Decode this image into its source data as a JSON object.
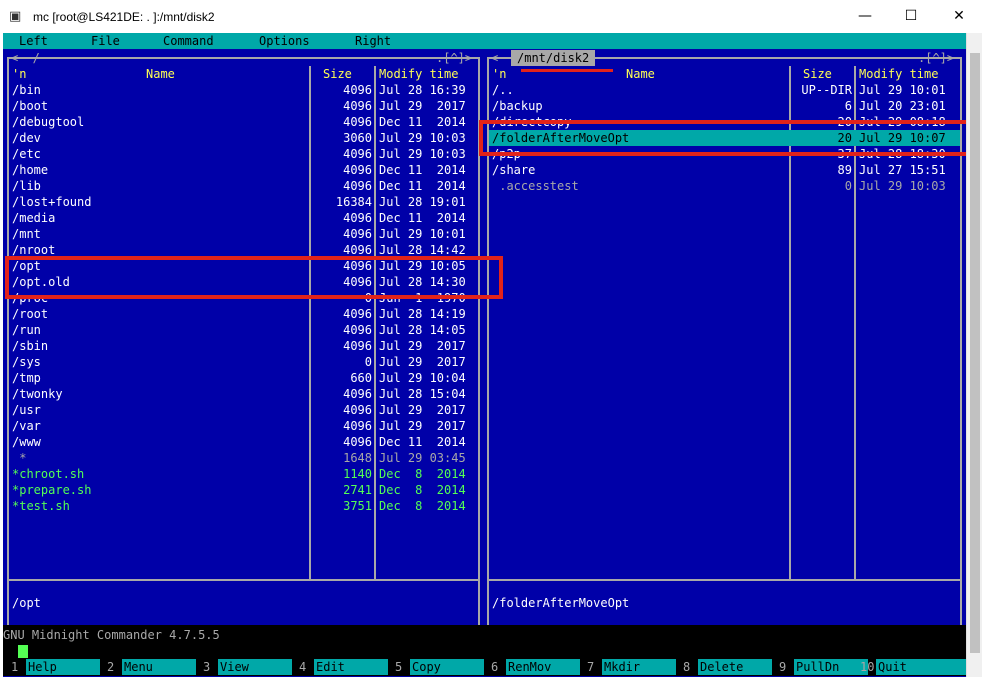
{
  "window": {
    "title": "mc [root@LS421DE:  .   ]:/mnt/disk2",
    "icon_name": "putty-icon",
    "minimize_icon": "—",
    "maximize_icon": "☐",
    "close_icon": "✕"
  },
  "menu": [
    "Left",
    "File",
    "Command",
    "Options",
    "Right"
  ],
  "left_panel": {
    "top_left": "<─ /",
    "top_right": ".[^]>",
    "col_n": "'n",
    "col_name": "Name",
    "col_size": "Size",
    "col_time": "Modify time",
    "files": [
      {
        "name": "/bin",
        "size": "4096",
        "time": "Jul 28 16:39",
        "kind": "dir"
      },
      {
        "name": "/boot",
        "size": "4096",
        "time": "Jul 29  2017",
        "kind": "dir"
      },
      {
        "name": "/debugtool",
        "size": "4096",
        "time": "Dec 11  2014",
        "kind": "dir"
      },
      {
        "name": "/dev",
        "size": "3060",
        "time": "Jul 29 10:03",
        "kind": "dir"
      },
      {
        "name": "/etc",
        "size": "4096",
        "time": "Jul 29 10:03",
        "kind": "dir"
      },
      {
        "name": "/home",
        "size": "4096",
        "time": "Dec 11  2014",
        "kind": "dir"
      },
      {
        "name": "/lib",
        "size": "4096",
        "time": "Dec 11  2014",
        "kind": "dir"
      },
      {
        "name": "/lost+found",
        "size": "16384",
        "time": "Jul 28 19:01",
        "kind": "dir"
      },
      {
        "name": "/media",
        "size": "4096",
        "time": "Dec 11  2014",
        "kind": "dir"
      },
      {
        "name": "/mnt",
        "size": "4096",
        "time": "Jul 29 10:01",
        "kind": "dir"
      },
      {
        "name": "/nroot",
        "size": "4096",
        "time": "Jul 28 14:42",
        "kind": "dir"
      },
      {
        "name": "/opt",
        "size": "4096",
        "time": "Jul 29 10:05",
        "kind": "dir"
      },
      {
        "name": "/opt.old",
        "size": "4096",
        "time": "Jul 28 14:30",
        "kind": "dir"
      },
      {
        "name": "/proc",
        "size": "0",
        "time": "Jun  1  1970",
        "kind": "dir"
      },
      {
        "name": "/root",
        "size": "4096",
        "time": "Jul 28 14:19",
        "kind": "dir"
      },
      {
        "name": "/run",
        "size": "4096",
        "time": "Jul 28 14:05",
        "kind": "dir"
      },
      {
        "name": "/sbin",
        "size": "4096",
        "time": "Jul 29  2017",
        "kind": "dir"
      },
      {
        "name": "/sys",
        "size": "0",
        "time": "Jul 29  2017",
        "kind": "dir"
      },
      {
        "name": "/tmp",
        "size": "660",
        "time": "Jul 29 10:04",
        "kind": "dir"
      },
      {
        "name": "/twonky",
        "size": "4096",
        "time": "Jul 28 15:04",
        "kind": "dir"
      },
      {
        "name": "/usr",
        "size": "4096",
        "time": "Jul 29  2017",
        "kind": "dir"
      },
      {
        "name": "/var",
        "size": "4096",
        "time": "Jul 29  2017",
        "kind": "dir"
      },
      {
        "name": "/www",
        "size": "4096",
        "time": "Dec 11  2014",
        "kind": "dir"
      },
      {
        "name": " *",
        "size": "1648",
        "time": "Jul 29 03:45",
        "kind": "dim"
      },
      {
        "name": "*chroot.sh",
        "size": "1140",
        "time": "Dec  8  2014",
        "kind": "exe"
      },
      {
        "name": "*prepare.sh",
        "size": "2741",
        "time": "Dec  8  2014",
        "kind": "exe"
      },
      {
        "name": "*test.sh",
        "size": "3751",
        "time": "Dec  8  2014",
        "kind": "exe"
      }
    ],
    "status": "/opt"
  },
  "right_panel": {
    "path": "/mnt/disk2",
    "top_left": "<─",
    "top_right": ".[^]>",
    "col_n": "'n",
    "col_name": "Name",
    "col_size": "Size",
    "col_time": "Modify time",
    "files": [
      {
        "name": "/..",
        "size": "UP--DIR",
        "time": "Jul 29 10:01",
        "kind": "dir"
      },
      {
        "name": "/backup",
        "size": "6",
        "time": "Jul 20 23:01",
        "kind": "dir"
      },
      {
        "name": "/directcopy",
        "size": "20",
        "time": "Jul 29 08:18",
        "kind": "dir"
      },
      {
        "name": "/folderAfterMoveOpt",
        "size": "20",
        "time": "Jul 29 10:07",
        "kind": "selected"
      },
      {
        "name": "/p2p",
        "size": "37",
        "time": "Jul 28 18:30",
        "kind": "dir"
      },
      {
        "name": "/share",
        "size": "89",
        "time": "Jul 27 15:51",
        "kind": "dir"
      },
      {
        "name": " .accesstest",
        "size": "0",
        "time": "Jul 29 10:03",
        "kind": "dim"
      }
    ],
    "status": "/folderAfterMoveOpt"
  },
  "command_line": {
    "text": "GNU Midnight Commander 4.7.5.5"
  },
  "function_keys": [
    {
      "num": "1",
      "label": "Help"
    },
    {
      "num": "2",
      "label": "Menu"
    },
    {
      "num": "3",
      "label": "View"
    },
    {
      "num": "4",
      "label": "Edit"
    },
    {
      "num": "5",
      "label": "Copy"
    },
    {
      "num": "6",
      "label": "RenMov"
    },
    {
      "num": "7",
      "label": "Mkdir"
    },
    {
      "num": "8",
      "label": "Delete"
    },
    {
      "num": "9",
      "label": "PullDn"
    },
    {
      "num": "10",
      "label": "Quit"
    }
  ],
  "colors": {
    "panel_bg": "#0000a8",
    "menu_bg": "#00a8a8",
    "directory": "#ffffff",
    "executable": "#54ff54",
    "header": "#ffff54",
    "annotation": "#e2231a"
  }
}
